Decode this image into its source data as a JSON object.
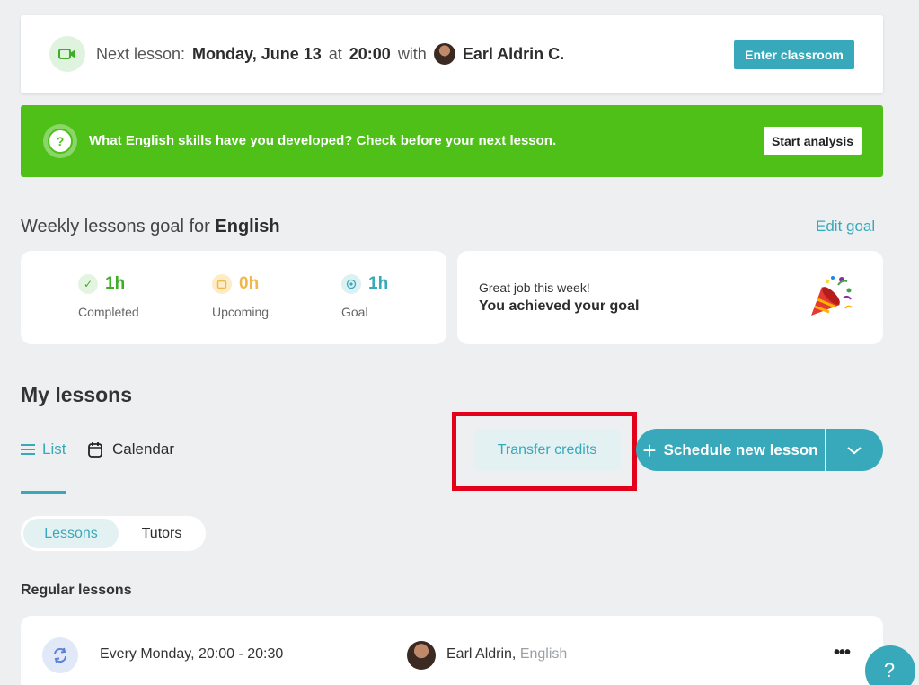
{
  "next_lesson": {
    "label": "Next lesson:",
    "date": "Monday, June 13",
    "at": "at",
    "time": "20:00",
    "with": "with",
    "tutor": "Earl Aldrin C.",
    "button": "Enter classroom"
  },
  "banner": {
    "icon": "?",
    "text": "What English skills have you developed? Check before your next lesson.",
    "button": "Start analysis"
  },
  "weekly_goal": {
    "title_prefix": "Weekly lessons goal for",
    "language": "English",
    "edit_label": "Edit goal",
    "stats": {
      "completed": {
        "value": "1h",
        "label": "Completed"
      },
      "upcoming": {
        "value": "0h",
        "label": "Upcoming"
      },
      "goal": {
        "value": "1h",
        "label": "Goal"
      }
    },
    "praise": {
      "subtitle": "Great job this week!",
      "message": "You achieved your goal"
    }
  },
  "my_lessons": {
    "title": "My lessons",
    "tabs": {
      "list": "List",
      "calendar": "Calendar"
    },
    "transfer_button": "Transfer credits",
    "schedule_button": "Schedule new lesson",
    "segments": {
      "lessons": "Lessons",
      "tutors": "Tutors"
    },
    "regular_title": "Regular lessons",
    "regular": [
      {
        "schedule": "Every Monday, 20:00 - 20:30",
        "tutor": "Earl Aldrin,",
        "language": "English"
      }
    ]
  },
  "help": {
    "label": "?"
  },
  "colors": {
    "accent": "#37a9ba",
    "success": "#4ec018",
    "highlight": "#e2001a"
  }
}
